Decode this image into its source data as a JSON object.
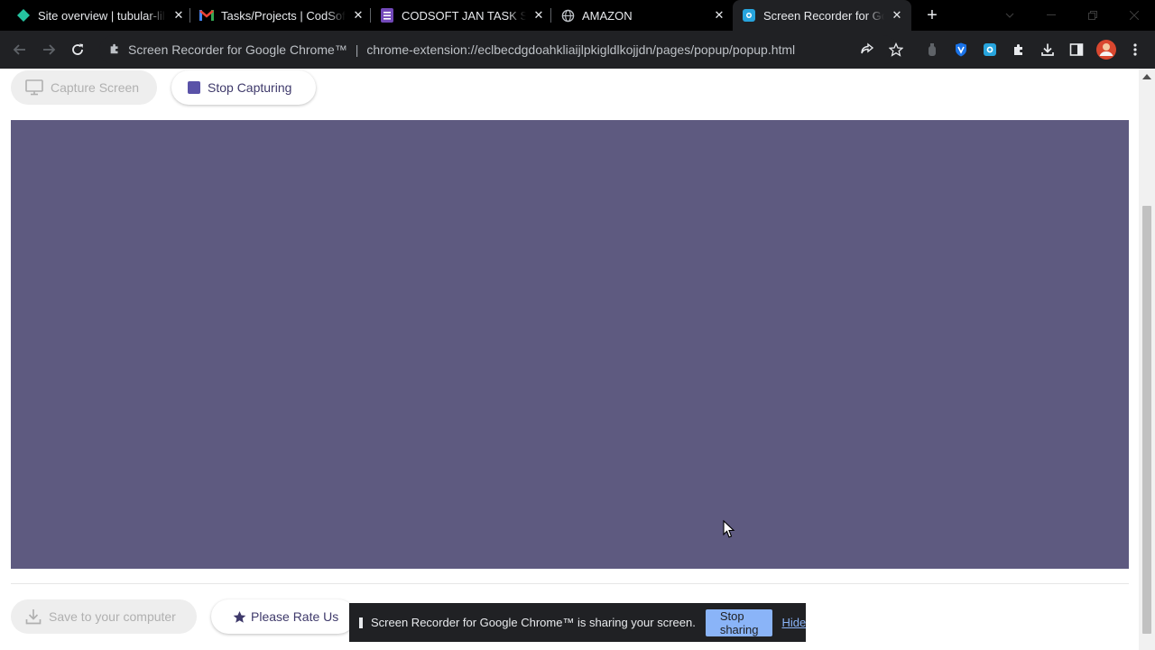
{
  "browser": {
    "tabs": [
      {
        "title": "Site overview | tubular-lil",
        "icon": "netlify-diamond-icon",
        "active": false
      },
      {
        "title": "Tasks/Projects | CodSoft I",
        "icon": "gmail-icon",
        "active": false
      },
      {
        "title": "CODSOFT JAN TASK SUB",
        "icon": "google-forms-icon",
        "active": false
      },
      {
        "title": "AMAZON",
        "icon": "globe-icon",
        "active": false
      },
      {
        "title": "Screen Recorder for Goo",
        "icon": "screen-recorder-icon",
        "active": true
      }
    ],
    "new_tab_label": "+",
    "omnibox": {
      "origin": "Screen Recorder for Google Chrome™",
      "separator": "|",
      "url": "chrome-extension://eclbecdgdoahkliaijlpkigldlkojjdn/pages/popup/popup.html"
    }
  },
  "page": {
    "capture_button": "Capture Screen",
    "stop_button": "Stop Capturing",
    "save_button": "Save to your computer",
    "rate_button": "Please Rate Us"
  },
  "sharing_bar": {
    "message": "Screen Recorder for Google Chrome™ is sharing your screen.",
    "stop_label": "Stop sharing",
    "hide_label": "Hide"
  },
  "colors": {
    "preview": "#5e5a80",
    "accent": "#3f3a6b",
    "share_button": "#8ab4f8"
  }
}
